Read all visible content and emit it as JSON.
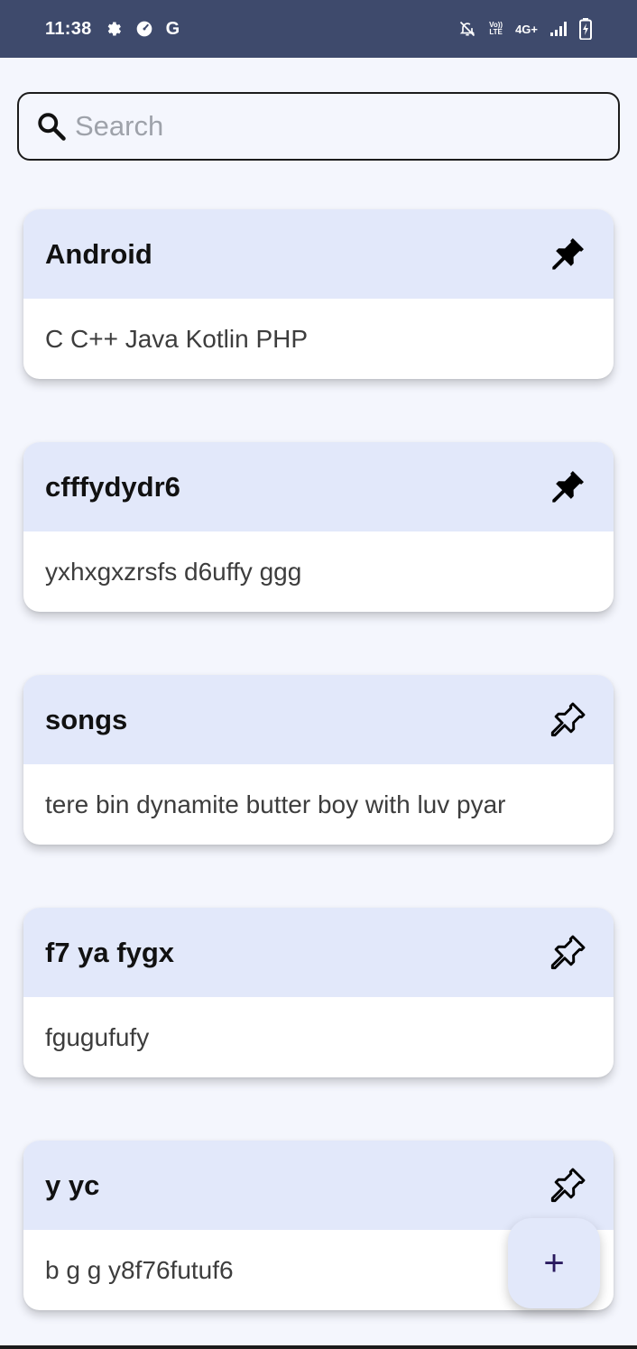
{
  "status_bar": {
    "time": "11:38",
    "left_icons": [
      "settings-icon",
      "speedometer-icon",
      "google-icon"
    ],
    "google_letter": "G",
    "network_text": "4G+",
    "volte_top": "Vo))",
    "volte_bottom": "LTE",
    "right_icons": [
      "notifications-off-icon",
      "volte-icon",
      "network-type",
      "signal-icon",
      "battery-charging-icon"
    ]
  },
  "search": {
    "placeholder": "Search",
    "value": ""
  },
  "notes": [
    {
      "title": "Android",
      "body": "C C++ Java Kotlin PHP",
      "pinned": true
    },
    {
      "title": "cfffydydr6",
      "body": "yxhxgxzrsfs d6uffy ggg",
      "pinned": true
    },
    {
      "title": "songs",
      "body": "tere bin dynamite butter boy with luv pyar",
      "pinned": false
    },
    {
      "title": "f7 ya fygx",
      "body": "fgugufufy",
      "pinned": false
    },
    {
      "title": "y yc",
      "body": "b g g y8f76futuf6",
      "pinned": false
    }
  ],
  "fab": {
    "label": "+"
  },
  "colors": {
    "status_bar": "#3e4a6c",
    "background": "#f4f6fd",
    "card_header": "#e2e8fa",
    "fab": "#e2e8fa",
    "fab_icon": "#2a1a5e"
  }
}
